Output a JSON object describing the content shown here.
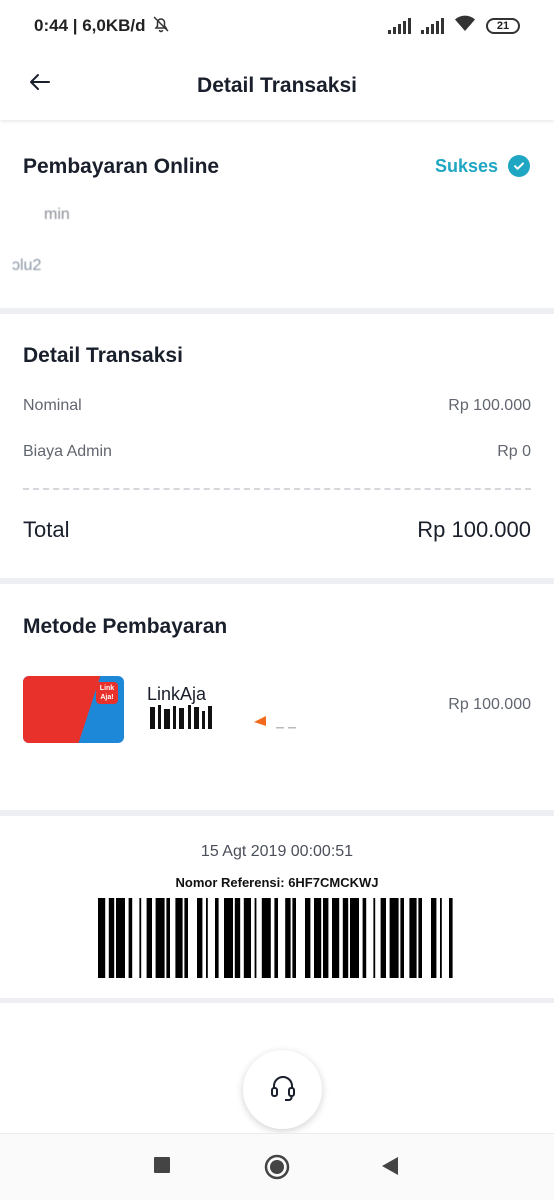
{
  "status_bar": {
    "time_speed": "0:44 | 6,0KB/d",
    "battery": "21",
    "icons": [
      "mute-bell-icon",
      "signal-icon",
      "signal-icon",
      "wifi-icon",
      "battery-icon"
    ]
  },
  "header": {
    "title": "Detail Transaksi",
    "back_icon": "arrow-left-icon"
  },
  "payment": {
    "title": "Pembayaran Online",
    "status": "Sukses",
    "status_color": "#1fa6c3",
    "line1": "min",
    "line2": "ɔlu2"
  },
  "details": {
    "title": "Detail Transaksi",
    "nominal_label": "Nominal",
    "nominal_value": "Rp 100.000",
    "fee_label": "Biaya Admin",
    "fee_value": "Rp 0",
    "total_label": "Total",
    "total_value": "Rp 100.000"
  },
  "method": {
    "title": "Metode Pembayaran",
    "name": "LinkAja",
    "amount": "Rp 100.000",
    "card_badge": "Link Aja!"
  },
  "receipt": {
    "datetime": "15 Agt 2019 00:00:51",
    "reference": "Nomor Referensi: 6HF7CMCKWJ"
  },
  "fab": {
    "icon": "headset-icon"
  },
  "nav": {
    "icons": [
      "square-icon",
      "home-circle-icon",
      "back-triangle-icon"
    ]
  }
}
